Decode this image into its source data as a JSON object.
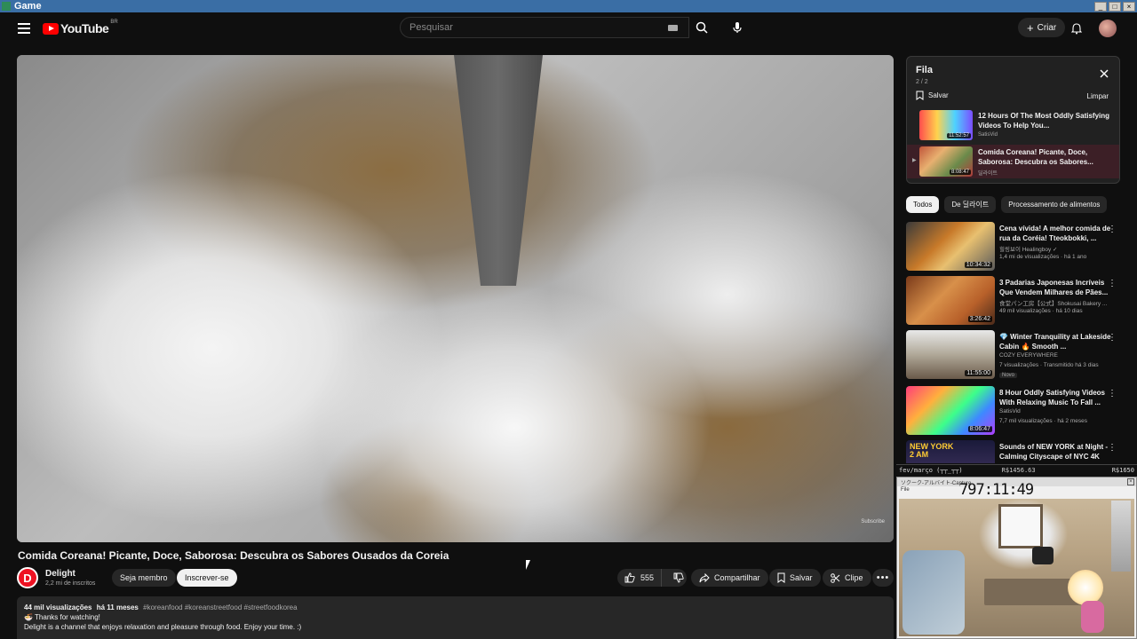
{
  "window": {
    "title": "Game"
  },
  "masthead": {
    "logo_text": "YouTube",
    "region": "BR",
    "search_placeholder": "Pesquisar",
    "create_label": "Criar"
  },
  "video": {
    "title": "Comida Coreana! Picante, Doce, Saborosa: Descubra os Sabores Ousados da Coreia",
    "watermark": "Subscribe",
    "channel": {
      "initial": "D",
      "name": "Delight",
      "subs": "2,2 mi de inscritos"
    },
    "member_label": "Seja membro",
    "subscribe_label": "Inscrever-se",
    "likes": "555",
    "share_label": "Compartilhar",
    "save_label": "Salvar",
    "clip_label": "Clipe",
    "description": {
      "views": "44 mil visualizações",
      "age": "há 11 meses",
      "tags": "#koreanfood #koreanstreetfood #streetfoodkorea",
      "line1": "Thanks for watching!",
      "line2": "Delight is a channel that enjoys relaxation and pleasure through food. Enjoy your time. :)"
    }
  },
  "queue": {
    "title": "Fila",
    "count": "2 / 2",
    "save_label": "Salvar",
    "clear_label": "Limpar",
    "items": [
      {
        "title": "12 Hours Of The Most Oddly Satisfying Videos To Help You...",
        "channel": "SatisVid",
        "duration": "11:52:57"
      },
      {
        "title": "Comida Coreana! Picante, Doce, Saborosa: Descubra os Sabores...",
        "channel": "딜라이트",
        "duration": "8:08:47"
      }
    ]
  },
  "chips": [
    {
      "label": "Todos",
      "selected": true
    },
    {
      "label": "De 딜라이트",
      "selected": false
    },
    {
      "label": "Processamento de alimentos",
      "selected": false
    }
  ],
  "recommendations": [
    {
      "title": "Cena vívida! A melhor comida de rua da Coréia! Tteokbokki, ...",
      "channel": "힐링보이 Healingboy ✓",
      "meta": "1,4 mi de visualizações · há 1 ano",
      "duration": "10:34:32",
      "badge": ""
    },
    {
      "title": "3 Padarias Japonesas Incríveis Que Vendem Milhares de Pães...",
      "channel": "食堂パン工房【公式】Shokusai Bakery ...",
      "meta": "49 mil visualizações · há 10 dias",
      "duration": "3:26:42",
      "badge": ""
    },
    {
      "title": "💎 Winter Tranquility at Lakeside Cabin 🔥 Smooth ...",
      "channel": "COZY EVERYWHERE",
      "meta": "7 visualizações · Transmitido há 3 dias",
      "duration": "11:55:00",
      "badge": "Novo"
    },
    {
      "title": "8 Hour Oddly Satisfying Videos With Relaxing Music To Fall ...",
      "channel": "SatisVid",
      "meta": "7,7 mil visualizações · há 2 meses",
      "duration": "8:06:47",
      "badge": ""
    },
    {
      "title": "Sounds of NEW YORK at Night - Calming Cityscape of NYC 4K",
      "channel": "",
      "meta": "",
      "duration": "",
      "badge": "",
      "thumb_text": "NEW YORK 2 AM"
    }
  ],
  "overlay": {
    "left": "fev/março (┬┬_┬┬)",
    "mid": "R$1456.63",
    "right": "R$1650",
    "cam_title": "ソクーク-アルバイト-Capture",
    "cam_menu": "File",
    "clock": "797:11:49"
  },
  "colors": {
    "accent": "#ff0000",
    "background": "#0f0f0f",
    "surface": "#272727"
  }
}
